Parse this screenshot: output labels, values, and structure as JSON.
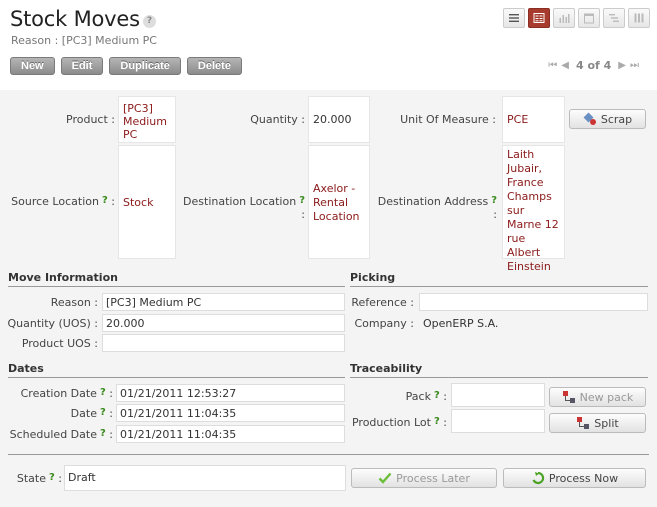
{
  "header": {
    "title": "Stock Moves",
    "help": "?",
    "subtitle": "Reason : [PC3] Medium PC"
  },
  "views": [
    {
      "name": "list-view-icon",
      "active": false
    },
    {
      "name": "form-view-icon",
      "active": true
    },
    {
      "name": "graph-view-icon",
      "active": false
    },
    {
      "name": "calendar-view-icon",
      "active": false
    },
    {
      "name": "gantt-view-icon",
      "active": false
    },
    {
      "name": "kanban-view-icon",
      "active": false
    }
  ],
  "actions": {
    "new": "New",
    "edit": "Edit",
    "duplicate": "Duplicate",
    "delete": "Delete"
  },
  "pager": {
    "text": "4 of 4"
  },
  "form": {
    "product_label": "Product :",
    "product_value": "[PC3] Medium PC",
    "quantity_label": "Quantity :",
    "quantity_value": "20.000",
    "uom_label": "Unit Of Measure :",
    "uom_value": "PCE",
    "scrap_button": "Scrap",
    "source_label": "Source Location",
    "source_value": "Stock",
    "dest_label": "Destination Location",
    "dest_value": "Axelor - Rental Location",
    "address_label": "Destination Address",
    "address_value": "Laith Jubair, France Champs sur Marne 12 rue Albert Einstein",
    "colon": ":",
    "q": "?"
  },
  "move_info": {
    "title": "Move Information",
    "reason_label": "Reason :",
    "reason_value": "[PC3] Medium PC",
    "qty_uos_label": "Quantity (UOS) :",
    "qty_uos_value": "20.000",
    "product_uos_label": "Product UOS :",
    "product_uos_value": ""
  },
  "picking": {
    "title": "Picking",
    "reference_label": "Reference :",
    "reference_value": "",
    "company_label": "Company :",
    "company_value": "OpenERP S.A."
  },
  "dates": {
    "title": "Dates",
    "creation_label": "Creation Date",
    "creation_value": "01/21/2011 12:53:27",
    "date_label": "Date",
    "date_value": "01/21/2011 11:04:35",
    "scheduled_label": "Scheduled Date",
    "scheduled_value": "01/21/2011 11:04:35"
  },
  "traceability": {
    "title": "Traceability",
    "pack_label": "Pack",
    "pack_value": "",
    "new_pack_button": "New pack",
    "lot_label": "Production Lot",
    "lot_value": "",
    "split_button": "Split"
  },
  "state": {
    "label": "State",
    "value": "Draft",
    "process_later": "Process Later",
    "process_now": "Process Now"
  }
}
